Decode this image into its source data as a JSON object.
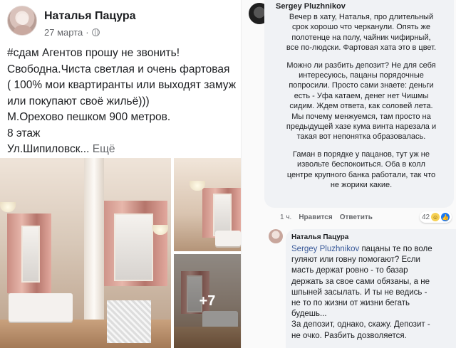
{
  "post": {
    "author": "Наталья Пацура",
    "date": "27 марта",
    "separator": "·",
    "text_lines": [
      "#сдам Агентов прошу не звонить!",
      "Свободна.Чиста светлая и очень фартовая",
      "( 100% мои квартиранты или выходят замуж",
      "или покупают своё жильё)))",
      "М.Орехово пешком 900 метров.",
      "8 этаж"
    ],
    "last_line": "Ул.Шипиловск...",
    "see_more": "Ещё",
    "more_photos": "+7",
    "icons": {
      "privacy": "globe-icon"
    }
  },
  "comment1": {
    "author": "Sergey Pluzhnikov",
    "paragraph1": [
      "Вечер в хату, Наталья, про длительный",
      "срок хорошо что черканули. Опять же",
      "полотенце на полу, чайник чифирный,",
      "все по-людски. Фартовая хата это в цвет."
    ],
    "paragraph2": [
      "Можно ли разбить депозит? Не для себя",
      "интересуюсь, пацаны порядочные",
      "попросили. Просто сами знаете: деньги",
      "есть - Уфа катаем, денег нет Чишмы",
      "сидим. Ждем ответа, как соловей лета.",
      "Мы почему менжуемся, там просто на",
      "предыдущей хазе кума винта нарезала и",
      "такая вот непонятка образовалась."
    ],
    "paragraph3": [
      "Гаман в порядке у пацанов, тут уж не",
      "извольте беспокоиться. Оба в колл",
      "центре крупного банка работали, так что",
      "не жорики какие."
    ],
    "time": "1 ч.",
    "like": "Нравится",
    "reply": "Ответить",
    "reactions_count": "42",
    "icons": {
      "haha": "haha-icon",
      "like": "like-icon"
    }
  },
  "comment2": {
    "author": "Наталья Пацура",
    "mention": "Sergey Pluzhnikov",
    "first_line_rest": " пацаны те по воле",
    "lines": [
      "гуляют или говну помогают? Если",
      "масть держат ровно - то базар",
      "держать за свое сами  обязаны, а не",
      "шпыней засылать. И ты не ведись -",
      "не то по жизни от жизни бегать",
      "будешь...",
      "За депозит, однако, скажу. Депозит -",
      "не очко. Разбить дозволяется."
    ]
  },
  "colors": {
    "link": "#385898",
    "bubble": "#f0f2f5",
    "meta": "#65676b",
    "like_blue": "#1877f2"
  }
}
